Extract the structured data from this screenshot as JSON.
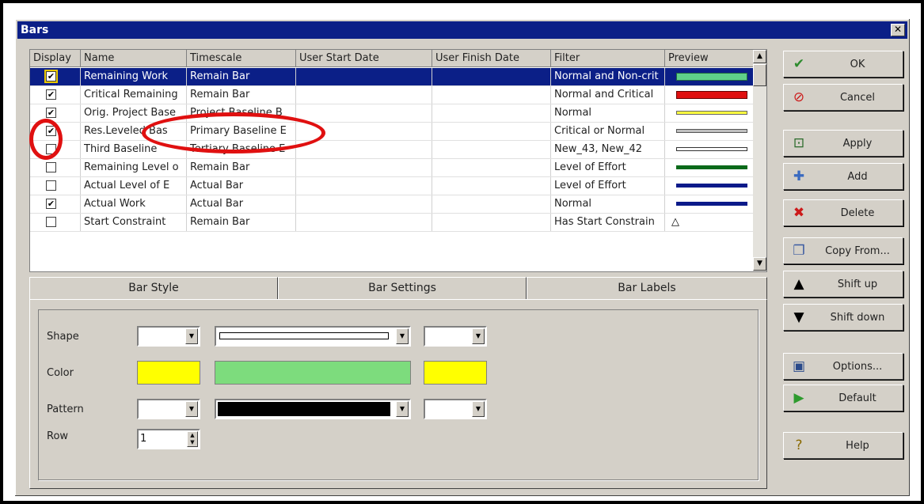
{
  "window": {
    "title": "Bars",
    "close_label": "✕"
  },
  "grid": {
    "headers": [
      "Display",
      "Name",
      "Timescale",
      "User Start Date",
      "User Finish Date",
      "Filter",
      "Preview"
    ],
    "rows": [
      {
        "display": true,
        "name": "Remaining Work",
        "timescale": "Remain Bar",
        "start": "",
        "finish": "",
        "filter": "Normal and Non-crit",
        "preview": "green-light",
        "selected": true
      },
      {
        "display": true,
        "name": "Critical Remaining",
        "timescale": "Remain Bar",
        "start": "",
        "finish": "",
        "filter": "Normal and Critical",
        "preview": "red"
      },
      {
        "display": true,
        "name": "Orig. Project Base",
        "timescale": "Project Baseline B",
        "start": "",
        "finish": "",
        "filter": "Normal",
        "preview": "yellow-thin"
      },
      {
        "display": true,
        "name": "Res.Leveled Bas",
        "timescale": "Primary Baseline E",
        "start": "",
        "finish": "",
        "filter": "Critical or Normal",
        "preview": "gray-thin"
      },
      {
        "display": false,
        "name": "Third Baseline",
        "timescale": "Tertiary Baseline E",
        "start": "",
        "finish": "",
        "filter": "New_43, New_42",
        "preview": "white-thin"
      },
      {
        "display": false,
        "name": "Remaining Level o",
        "timescale": "Remain Bar",
        "start": "",
        "finish": "",
        "filter": "Level of Effort",
        "preview": "green-dark"
      },
      {
        "display": false,
        "name": "Actual Level of E",
        "timescale": "Actual Bar",
        "start": "",
        "finish": "",
        "filter": "Level of Effort",
        "preview": "navy"
      },
      {
        "display": true,
        "name": "Actual Work",
        "timescale": "Actual Bar",
        "start": "",
        "finish": "",
        "filter": "Normal",
        "preview": "navy"
      },
      {
        "display": false,
        "name": "Start Constraint",
        "timescale": "Remain Bar",
        "start": "",
        "finish": "",
        "filter": "Has Start Constrain",
        "preview": "triangle"
      }
    ],
    "check_glyph": "✔",
    "triangle_glyph": "△",
    "scroll_up": "▲",
    "scroll_down": "▼"
  },
  "tabs": [
    "Bar Style",
    "Bar Settings",
    "Bar Labels"
  ],
  "bar_style": {
    "shape_label": "Shape",
    "color_label": "Color",
    "pattern_label": "Pattern",
    "row_label": "Row",
    "row_value": "1",
    "dropdown_glyph": "▼",
    "spin_up": "▲",
    "spin_down": "▼",
    "colors": {
      "start": "#ffff00",
      "middle": "#7ddc7d",
      "end": "#ffff00"
    }
  },
  "buttons": [
    {
      "label": "OK",
      "icon": "check-icon",
      "glyph": "✔",
      "color": "#2e8b2e"
    },
    {
      "label": "Cancel",
      "icon": "cancel-icon",
      "glyph": "⊘",
      "color": "#cc1a1a"
    },
    {
      "label": "Apply",
      "icon": "apply-icon",
      "glyph": "⊡",
      "color": "#2a6a2a"
    },
    {
      "label": "Add",
      "icon": "add-icon",
      "glyph": "✚",
      "color": "#3a6ac0"
    },
    {
      "label": "Delete",
      "icon": "delete-icon",
      "glyph": "✖",
      "color": "#cc1a1a"
    },
    {
      "label": "Copy From...",
      "icon": "copy-icon",
      "glyph": "❐",
      "color": "#3a5aa0"
    },
    {
      "label": "Shift up",
      "icon": "shift-up-icon",
      "glyph": "▲",
      "color": "#000000"
    },
    {
      "label": "Shift down",
      "icon": "shift-down-icon",
      "glyph": "▼",
      "color": "#000000"
    },
    {
      "label": "Options...",
      "icon": "options-icon",
      "glyph": "▣",
      "color": "#2a4a8a"
    },
    {
      "label": "Default",
      "icon": "default-icon",
      "glyph": "▶",
      "color": "#2e9b2e"
    },
    {
      "label": "Help",
      "icon": "help-icon",
      "glyph": "?",
      "color": "#8a6a00"
    }
  ]
}
